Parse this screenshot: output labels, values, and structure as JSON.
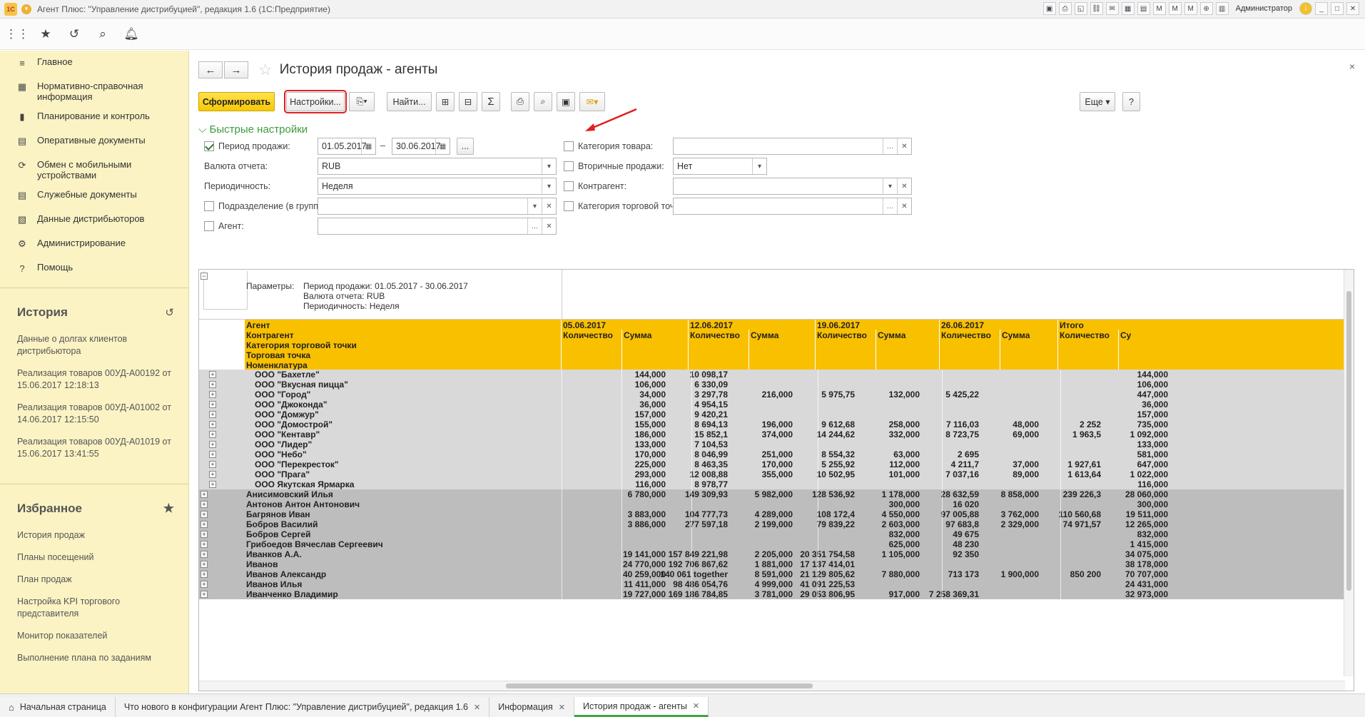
{
  "window": {
    "title": "Агент Плюс: \"Управление дистрибуцией\", редакция 1.6  (1С:Предприятие)",
    "logo": "1С",
    "user": "Администратор"
  },
  "nav_icons": [
    "apps-grid-icon",
    "favorites-star-icon",
    "history-icon",
    "search-icon",
    "notifications-bell-icon"
  ],
  "sidebar": {
    "sections": [
      {
        "label": "Главное",
        "icon": "menu-icon"
      },
      {
        "label": "Нормативно-справочная информация",
        "icon": "reference-books-icon"
      },
      {
        "label": "Планирование и контроль",
        "icon": "chart-icon"
      },
      {
        "label": "Оперативные документы",
        "icon": "documents-icon"
      },
      {
        "label": "Обмен с мобильными устройствами",
        "icon": "sync-icon"
      },
      {
        "label": "Служебные документы",
        "icon": "service-documents-icon"
      },
      {
        "label": "Данные дистрибьюторов",
        "icon": "distributors-icon"
      },
      {
        "label": "Администрирование",
        "icon": "gear-icon"
      },
      {
        "label": "Помощь",
        "icon": "help-icon"
      }
    ],
    "history_title": "История",
    "history": [
      "Данные о долгах клиентов дистрибьютора",
      "Реализация товаров 00УД-А00192 от 15.06.2017 12:18:13",
      "Реализация товаров 00УД-А01002 от 14.06.2017 12:15:50",
      "Реализация товаров 00УД-А01019 от 15.06.2017 13:41:55"
    ],
    "favorites_title": "Избранное",
    "favorites": [
      "История продаж",
      "Планы посещений",
      "План продаж",
      "Настройка KPI торгового представителя",
      "Монитор показателей",
      "Выполнение плана по заданиям"
    ]
  },
  "page": {
    "title": "История продаж - агенты",
    "close": "×"
  },
  "toolbar": {
    "generate": "Сформировать",
    "settings": "Настройки...",
    "find": "Найти...",
    "more": "Еще",
    "help": "?"
  },
  "quick": {
    "title": "Быстрые настройки",
    "period_label": "Период продажи:",
    "period_from": "01.05.2017",
    "period_to": "30.06.2017",
    "period_sep": "–",
    "period_btn": "...",
    "currency_label": "Валюта отчета:",
    "currency": "RUB",
    "periodicity_label": "Периодичность:",
    "periodicity": "Неделя",
    "division_label": "Подразделение (в группе):",
    "division": "",
    "agent_label": "Агент:",
    "agent": "",
    "category_label": "Категория товара:",
    "category": "",
    "secondary_label": "Вторичные продажи:",
    "secondary": "Нет",
    "contractor_label": "Контрагент:",
    "contractor": "",
    "outlet_cat_label": "Категория торговой точки:",
    "outlet_cat": ""
  },
  "report": {
    "params_label": "Параметры:",
    "params": [
      "Период продажи: 01.05.2017 - 30.06.2017",
      "Валюта отчета: RUB",
      "Периодичность: Неделя"
    ],
    "row_headers": [
      "Агент",
      "Контрагент",
      "Категория торговой точки",
      "Торговая точка",
      "Номенклатура"
    ],
    "periods": [
      "05.06.2017",
      "12.06.2017",
      "19.06.2017",
      "26.06.2017",
      "Итого"
    ],
    "col_qty": "Количество",
    "col_sum": "Сумма",
    "col_sum_cut": "Су",
    "rows": [
      {
        "name": "ООО \"Бахетле\"",
        "lvl": 2,
        "v": [
          "144,000",
          "10 098,17",
          "",
          "",
          "",
          "",
          "",
          "",
          "144,000"
        ]
      },
      {
        "name": "ООО \"Вкусная пицца\"",
        "lvl": 2,
        "v": [
          "106,000",
          "6 330,09",
          "",
          "",
          "",
          "",
          "",
          "",
          "106,000"
        ]
      },
      {
        "name": "ООО \"Город\"",
        "lvl": 2,
        "v": [
          "34,000",
          "3 297,78",
          "216,000",
          "5 975,75",
          "132,000",
          "5 425,22",
          "",
          "",
          "447,000"
        ]
      },
      {
        "name": "ООО \"Джоконда\"",
        "lvl": 2,
        "v": [
          "36,000",
          "4 954,15",
          "",
          "",
          "",
          "",
          "",
          "",
          "36,000"
        ]
      },
      {
        "name": "ООО \"Домжур\"",
        "lvl": 2,
        "v": [
          "157,000",
          "9 420,21",
          "",
          "",
          "",
          "",
          "",
          "",
          "157,000"
        ]
      },
      {
        "name": "ООО \"Домострой\"",
        "lvl": 2,
        "v": [
          "155,000",
          "8 694,13",
          "196,000",
          "9 612,68",
          "258,000",
          "7 116,03",
          "48,000",
          "2 252",
          "735,000"
        ]
      },
      {
        "name": "ООО \"Кентавр\"",
        "lvl": 2,
        "v": [
          "186,000",
          "15 852,1",
          "374,000",
          "14 244,62",
          "332,000",
          "8 723,75",
          "69,000",
          "1 963,5",
          "1 092,000"
        ]
      },
      {
        "name": "ООО \"Лидер\"",
        "lvl": 2,
        "v": [
          "133,000",
          "7 104,53",
          "",
          "",
          "",
          "",
          "",
          "",
          "133,000"
        ]
      },
      {
        "name": "ООО \"Небо\"",
        "lvl": 2,
        "v": [
          "170,000",
          "8 046,99",
          "251,000",
          "8 554,32",
          "63,000",
          "2 695",
          "",
          "",
          "581,000"
        ]
      },
      {
        "name": "ООО \"Перекресток\"",
        "lvl": 2,
        "v": [
          "225,000",
          "8 463,35",
          "170,000",
          "5 255,92",
          "112,000",
          "4 211,7",
          "37,000",
          "1 927,61",
          "647,000"
        ]
      },
      {
        "name": "ООО \"Прага\"",
        "lvl": 2,
        "v": [
          "293,000",
          "12 008,88",
          "355,000",
          "10 502,95",
          "101,000",
          "7 037,16",
          "89,000",
          "1 613,64",
          "1 022,000"
        ]
      },
      {
        "name": "ООО Якутская Ярмарка",
        "lvl": 2,
        "v": [
          "116,000",
          "8 978,77",
          "",
          "",
          "",
          "",
          "",
          "",
          "116,000"
        ]
      },
      {
        "name": "Анисимовский Илья",
        "lvl": 1,
        "v": [
          "6 780,000",
          "149 309,93",
          "5 982,000",
          "128 536,92",
          "1 178,000",
          "28 632,59",
          "8 858,000",
          "239 226,3",
          "28 060,000"
        ]
      },
      {
        "name": "Антонов Антон Антонович",
        "lvl": 1,
        "v": [
          "",
          "",
          "",
          "",
          "300,000",
          "16 020",
          "",
          "",
          "300,000"
        ]
      },
      {
        "name": "Багрянов Иван",
        "lvl": 1,
        "v": [
          "3 883,000",
          "104 777,73",
          "4 289,000",
          "108 172,4",
          "4 550,000",
          "97 005,88",
          "3 762,000",
          "110 560,68",
          "19 511,000"
        ]
      },
      {
        "name": "Бобров Василий",
        "lvl": 1,
        "v": [
          "3 886,000",
          "277 597,18",
          "2 199,000",
          "79 839,22",
          "2 603,000",
          "97 683,8",
          "2 329,000",
          "74 971,57",
          "12 265,000"
        ]
      },
      {
        "name": "Бобров Сергей",
        "lvl": 1,
        "v": [
          "",
          "",
          "",
          "",
          "832,000",
          "49 675",
          "",
          "",
          "832,000"
        ]
      },
      {
        "name": "Грибоедов Вячеслав Сергеевич",
        "lvl": 1,
        "v": [
          "",
          "",
          "",
          "",
          "625,000",
          "48 230",
          "",
          "",
          "1 415,000"
        ]
      },
      {
        "name": "Иванков А.А.",
        "lvl": 1,
        "v": [
          "19 141,000",
          "157 849 221,98",
          "2 205,000",
          "20 351 754,58",
          "1 105,000",
          "92 350",
          "",
          "",
          "34 075,000"
        ]
      },
      {
        "name": "Иванов",
        "lvl": 1,
        "v": [
          "24 770,000",
          "192 706 867,62",
          "1 881,000",
          "17 137 414,01",
          "",
          "",
          "",
          "",
          "38 178,000"
        ]
      },
      {
        "name": "Иванов Александр",
        "lvl": 1,
        "v": [
          "40 259,000",
          "140 061 together",
          "8 591,000",
          "21 129 805,62",
          "7 880,000",
          "713 173",
          "1 900,000",
          "850 200",
          "70 707,000"
        ]
      },
      {
        "name": "Иванов Илья",
        "lvl": 1,
        "v": [
          "11 411,000",
          "98 486 054,76",
          "4 999,000",
          "41 091 225,53",
          "",
          "",
          "",
          "",
          "24 431,000"
        ]
      },
      {
        "name": "Иванченко Владимир",
        "lvl": 1,
        "v": [
          "19 727,000",
          "169 186 784,85",
          "3 781,000",
          "29 053 806,95",
          "917,000",
          "7 258 369,31",
          "",
          "",
          "32 973,000"
        ]
      }
    ]
  },
  "tabs": [
    {
      "label": "Начальная страница",
      "icon": "home-icon",
      "closable": false
    },
    {
      "label": "Что нового в конфигурации Агент Плюс: \"Управление дистрибуцией\", редакция 1.6",
      "closable": true
    },
    {
      "label": "Информация",
      "closable": true
    },
    {
      "label": "История продаж - агенты",
      "closable": true,
      "active": true
    }
  ],
  "colors": {
    "accent_yellow": "#f9c000",
    "sidebar_bg": "#fbf3c4",
    "highlight_red": "#e02020",
    "green": "#3d9b3d"
  }
}
